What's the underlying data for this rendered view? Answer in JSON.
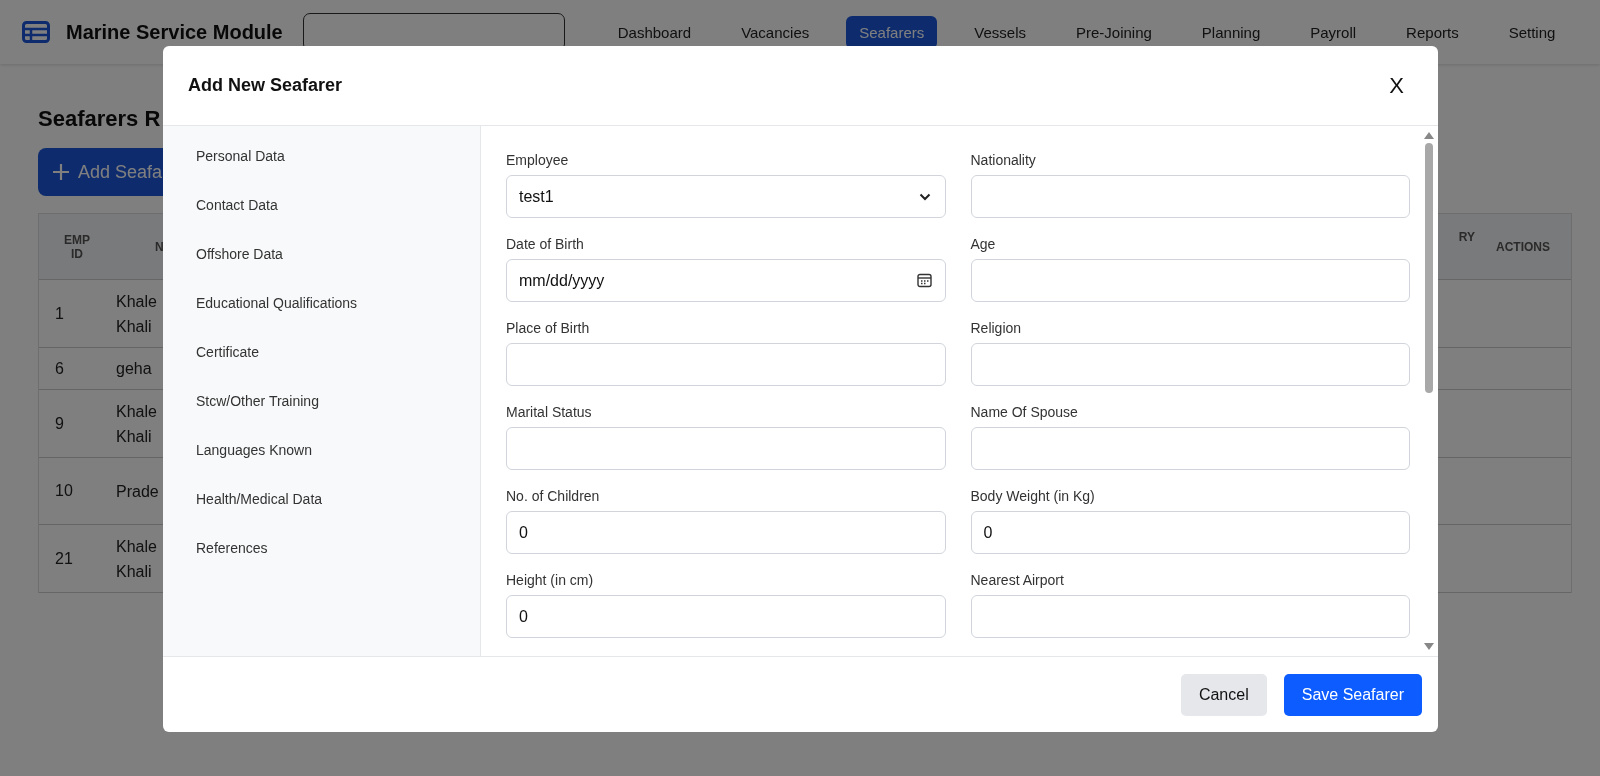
{
  "navbar": {
    "title": "Marine Service Module",
    "items": [
      {
        "label": "Dashboard",
        "selected": false
      },
      {
        "label": "Vacancies",
        "selected": false
      },
      {
        "label": "Seafarers",
        "selected": true
      },
      {
        "label": "Vessels",
        "selected": false
      },
      {
        "label": "Pre-Joining",
        "selected": false
      },
      {
        "label": "Planning",
        "selected": false
      },
      {
        "label": "Payroll",
        "selected": false
      },
      {
        "label": "Reports",
        "selected": false
      },
      {
        "label": "Setting",
        "selected": false
      }
    ]
  },
  "page": {
    "heading": "Seafarers R",
    "add_button": "Add Seafa",
    "table": {
      "columns": [
        "EMP ID",
        "N",
        "RY",
        "ACTIONS"
      ],
      "rows": [
        {
          "emp_id": "1",
          "name": "Khale Khali"
        },
        {
          "emp_id": "6",
          "name": "geha"
        },
        {
          "emp_id": "9",
          "name": "Khale Khali"
        },
        {
          "emp_id": "10",
          "name": "Prade"
        },
        {
          "emp_id": "21",
          "name": "Khale Khali"
        }
      ]
    }
  },
  "modal": {
    "title": "Add New Seafarer",
    "close": "X",
    "sections": [
      "Personal Data",
      "Contact Data",
      "Offshore Data",
      "Educational Qualifications",
      "Certificate",
      "Stcw/Other Training",
      "Languages Known",
      "Health/Medical Data",
      "References"
    ],
    "fields": [
      {
        "label": "Employee",
        "kind": "select",
        "value": "test1"
      },
      {
        "label": "Nationality",
        "kind": "text"
      },
      {
        "label": "Date of Birth",
        "kind": "date",
        "placeholder": "mm/dd/yyyy"
      },
      {
        "label": "Age",
        "kind": "text"
      },
      {
        "label": "Place of Birth",
        "kind": "text"
      },
      {
        "label": "Religion",
        "kind": "text"
      },
      {
        "label": "Marital Status",
        "kind": "text"
      },
      {
        "label": "Name Of Spouse",
        "kind": "text"
      },
      {
        "label": "No. of Children",
        "kind": "text",
        "value": "0"
      },
      {
        "label": "Body Weight (in Kg)",
        "kind": "text",
        "value": "0"
      },
      {
        "label": "Height (in cm)",
        "kind": "text",
        "value": "0"
      },
      {
        "label": "Nearest Airport",
        "kind": "text"
      }
    ],
    "buttons": [
      {
        "label": "Cancel",
        "kind": "secondary"
      },
      {
        "label": "Save Seafarer",
        "kind": "primary"
      }
    ]
  }
}
